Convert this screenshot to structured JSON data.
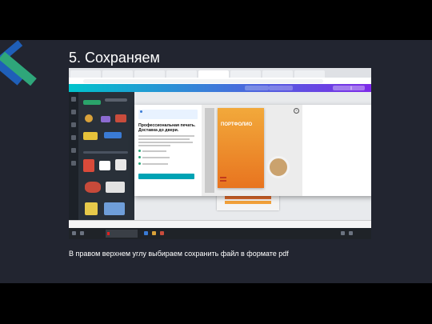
{
  "slide": {
    "title": "5. Сохраняем",
    "caption": "В правом верхнем углу выбираем сохранить файл в формате pdf",
    "background": "#222530",
    "accent_blue": "#1f5fb8",
    "accent_green": "#2fa67a"
  },
  "screenshot": {
    "modal": {
      "heading": "Профессиональная печать. Доставка до двери.",
      "book_title": "ПОРТФОЛИО"
    }
  }
}
